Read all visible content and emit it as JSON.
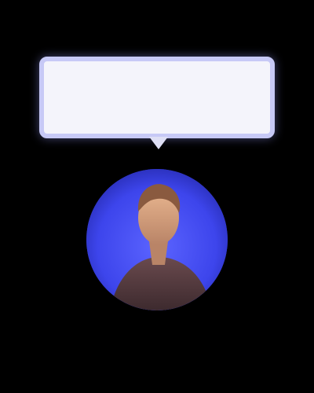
{
  "speech_bubble": {
    "text": ""
  },
  "profile": {
    "avatar_icon": "person-photo",
    "username": ""
  },
  "colors": {
    "background": "#000000",
    "bubble_fill": "#f4f4fb",
    "bubble_border": "#c7c9f6",
    "avatar_background": "#3f47f0"
  }
}
